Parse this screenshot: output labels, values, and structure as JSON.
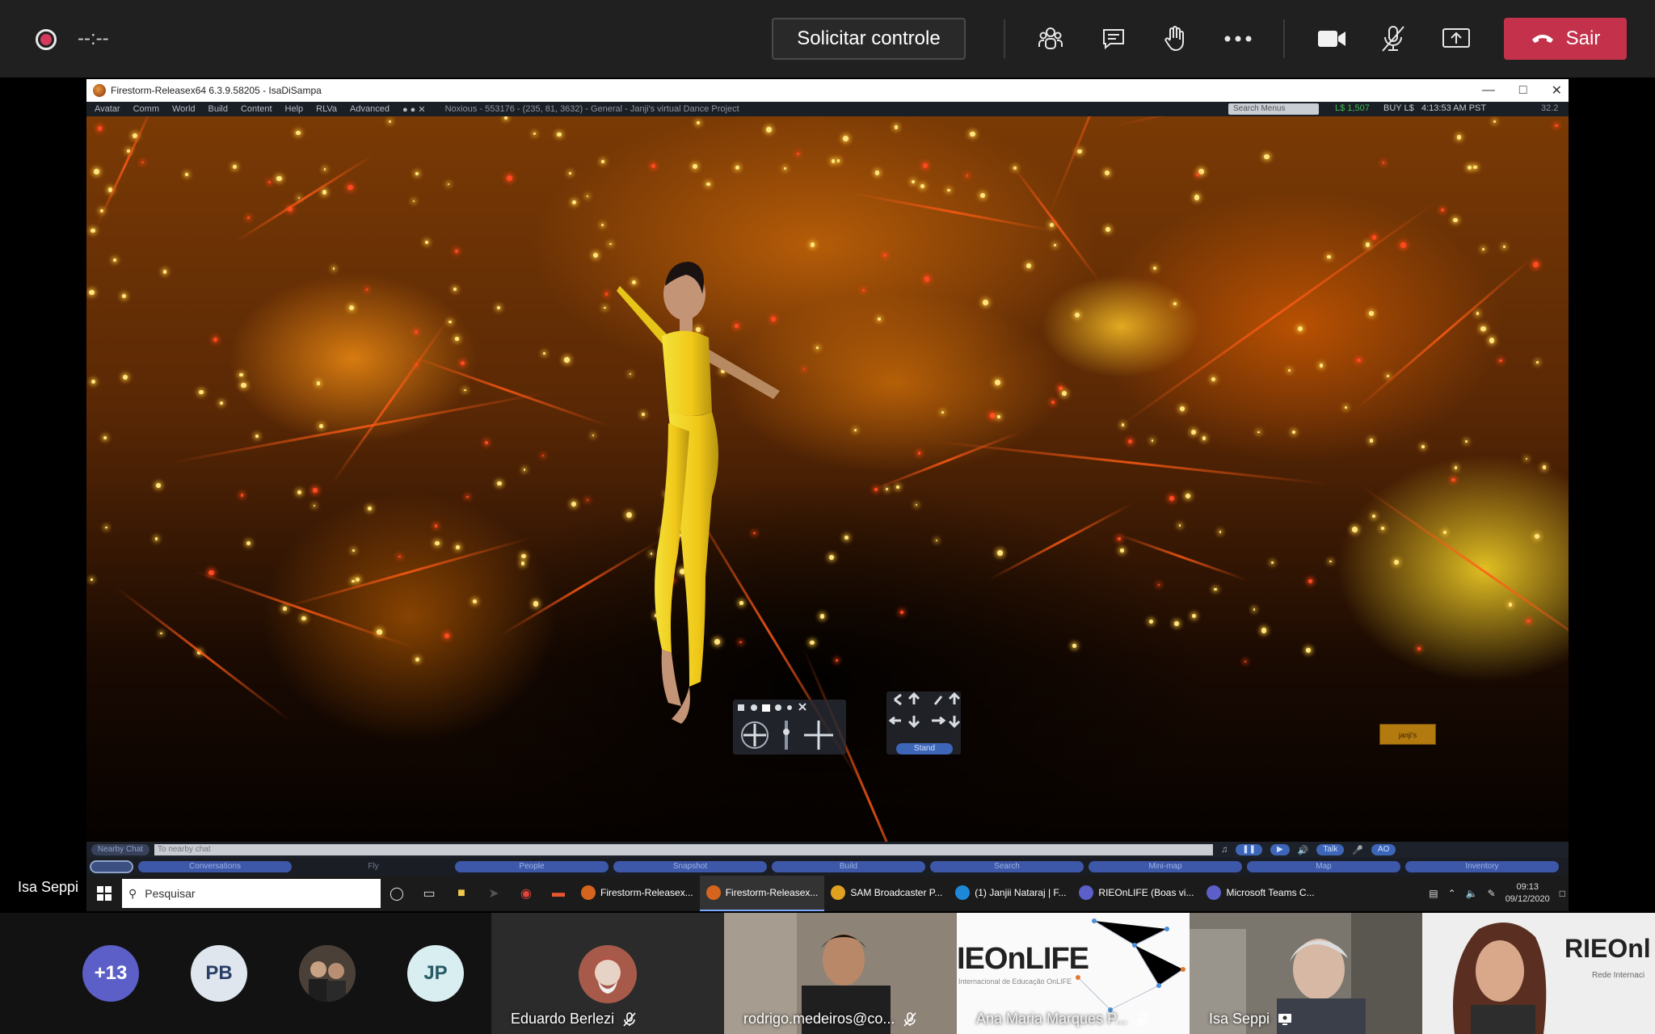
{
  "teams": {
    "timer": "--:--",
    "request_control": "Solicitar controle",
    "leave": "Sair",
    "presenter": "Isa Seppi",
    "icons": [
      "participants-icon",
      "chat-icon",
      "raise-hand-icon",
      "more-icon",
      "camera-icon",
      "mic-off-icon",
      "share-icon"
    ]
  },
  "firestorm": {
    "window_title": "Firestorm-Releasex64 6.3.9.58205 - IsaDiSampa",
    "menus": [
      "Avatar",
      "Comm",
      "World",
      "Build",
      "Content",
      "Help",
      "RLVa",
      "Advanced"
    ],
    "location": "Noxious - 553176 - (235, 81, 3632) - General - Janji's virtual Dance Project",
    "search_placeholder": "Search Menus",
    "balance": "L$ 1,507",
    "buy": "BUY L$",
    "time": "4:13:53 AM PST",
    "fps": "32.2",
    "stand": "Stand",
    "nearby_chat": "Nearby Chat",
    "chat_placeholder": "To nearby chat",
    "talk": "Talk",
    "ao": "AO",
    "logo_badge": "janji's",
    "bottom_buttons": [
      "Conversations",
      "Fly",
      "People",
      "Snapshot",
      "Build",
      "Search",
      "Mini-map",
      "Map",
      "Inventory"
    ]
  },
  "taskbar": {
    "search": "Pesquisar",
    "apps": [
      {
        "label": "Firestorm-Releasex...",
        "active": false,
        "color": "#d4641e"
      },
      {
        "label": "Firestorm-Releasex...",
        "active": true,
        "color": "#d4641e"
      },
      {
        "label": "SAM Broadcaster P...",
        "active": false,
        "color": "#e0a020"
      },
      {
        "label": "(1) Janjii Nataraj | F...",
        "active": false,
        "color": "#1e88d8"
      },
      {
        "label": "RIEOnLIFE (Boas vi...",
        "active": false,
        "color": "#5b5fc7"
      },
      {
        "label": "Microsoft Teams C...",
        "active": false,
        "color": "#5b5fc7"
      }
    ],
    "clock_time": "09:13",
    "clock_date": "09/12/2020"
  },
  "participants": {
    "overflow": "+13",
    "avatars": [
      {
        "initials": "PB",
        "bg": "#dfe6ee",
        "fg": "#2a3f66"
      },
      {
        "initials": "JP",
        "bg": "#d9eef1",
        "fg": "#275a66"
      }
    ],
    "tiles": [
      {
        "name": "Eduardo Berlezi"
      },
      {
        "name": "rodrigo.medeiros@co..."
      },
      {
        "name": "Ana Maria Marques P..."
      },
      {
        "name": "Isa Seppi"
      }
    ],
    "slide_text": "IEOnLIFE",
    "slide_text2": "RIEOnl",
    "slide_sub": "Internacional de Educação OnLIFE",
    "slide_sub2": "Rede Internaci"
  },
  "colors": {
    "teams_bar": "#202020",
    "leave_red": "#c4314b",
    "record_dot": "#d53a5c"
  }
}
